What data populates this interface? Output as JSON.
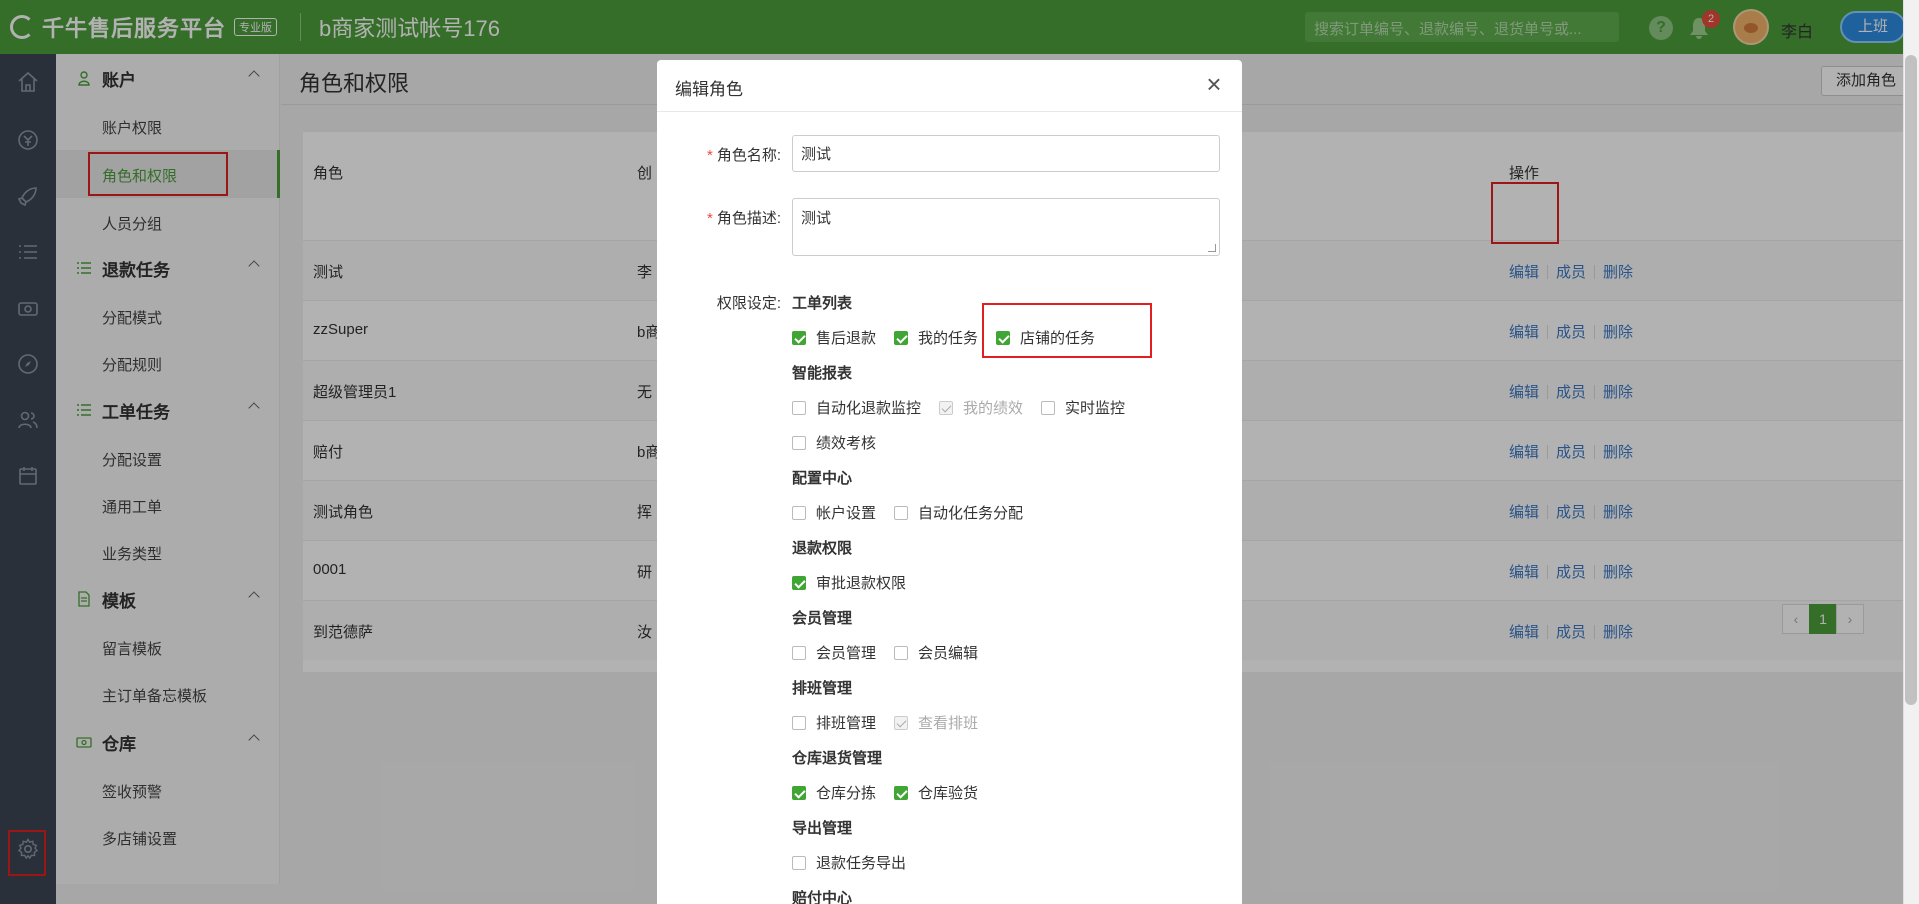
{
  "topbar": {
    "brand": "千牛售后服务平台",
    "edition_badge": "专业版",
    "shop": "b商家测试帐号176",
    "search_placeholder": "搜索订单编号、退款编号、退货单号或...",
    "help": "?",
    "notifications": "2",
    "user": "李白",
    "duty_button": "上班"
  },
  "sidebar": {
    "groups": [
      {
        "title": "账户",
        "items": [
          "账户权限",
          "角色和权限",
          "人员分组"
        ]
      },
      {
        "title": "退款任务",
        "items": [
          "分配模式",
          "分配规则"
        ]
      },
      {
        "title": "工单任务",
        "items": [
          "分配设置",
          "通用工单",
          "业务类型"
        ]
      },
      {
        "title": "模板",
        "items": [
          "留言模板",
          "主订单备忘模板"
        ]
      },
      {
        "title": "仓库",
        "items": [
          "签收预警",
          "多店铺设置"
        ]
      }
    ]
  },
  "main": {
    "title": "角色和权限",
    "add_role_button": "添加角色",
    "columns": {
      "role": "角色",
      "creator": "创",
      "ops": "操作"
    },
    "rows": [
      {
        "role": "测试",
        "creator": "李"
      },
      {
        "role": "zzSuper",
        "creator": "b商"
      },
      {
        "role": "超级管理员1",
        "creator": "无"
      },
      {
        "role": "赔付",
        "creator": "b商"
      },
      {
        "role": "测试角色",
        "creator": "挥"
      },
      {
        "role": "0001",
        "creator": "研"
      },
      {
        "role": "到范德萨",
        "creator": "汝"
      }
    ],
    "ops": {
      "edit": "编辑",
      "members": "成员",
      "delete": "删除"
    },
    "pager": {
      "prev": "‹",
      "current": "1",
      "next": "›"
    }
  },
  "modal": {
    "title": "编辑角色",
    "close": "×",
    "name_label": "角色名称:",
    "name_value": "测试",
    "desc_label": "角色描述:",
    "desc_value": "测试",
    "perm_label": "权限设定:",
    "sections": [
      {
        "title": "工单列表",
        "rows": [
          [
            {
              "label": "售后退款",
              "state": "on"
            },
            {
              "label": "我的任务",
              "state": "on"
            },
            {
              "label": "店铺的任务",
              "state": "on"
            }
          ]
        ]
      },
      {
        "title": "智能报表",
        "rows": [
          [
            {
              "label": "自动化退款监控",
              "state": "off"
            },
            {
              "label": "我的绩效",
              "state": "disabled"
            },
            {
              "label": "实时监控",
              "state": "off"
            }
          ],
          [
            {
              "label": "绩效考核",
              "state": "off"
            }
          ]
        ]
      },
      {
        "title": "配置中心",
        "rows": [
          [
            {
              "label": "帐户设置",
              "state": "off"
            },
            {
              "label": "自动化任务分配",
              "state": "off"
            }
          ]
        ]
      },
      {
        "title": "退款权限",
        "rows": [
          [
            {
              "label": "审批退款权限",
              "state": "on"
            }
          ]
        ]
      },
      {
        "title": "会员管理",
        "rows": [
          [
            {
              "label": "会员管理",
              "state": "off"
            },
            {
              "label": "会员编辑",
              "state": "off"
            }
          ]
        ]
      },
      {
        "title": "排班管理",
        "rows": [
          [
            {
              "label": "排班管理",
              "state": "off"
            },
            {
              "label": "查看排班",
              "state": "disabled"
            }
          ]
        ]
      },
      {
        "title": "仓库退货管理",
        "rows": [
          [
            {
              "label": "仓库分拣",
              "state": "on"
            },
            {
              "label": "仓库验货",
              "state": "on"
            }
          ]
        ]
      },
      {
        "title": "导出管理",
        "rows": [
          [
            {
              "label": "退款任务导出",
              "state": "off"
            }
          ]
        ]
      },
      {
        "title": "赔付中心",
        "rows": []
      }
    ]
  },
  "colors": {
    "brand_green": "#4c9e3b",
    "link_blue": "#3b78c4",
    "highlight_red": "#e02020"
  }
}
